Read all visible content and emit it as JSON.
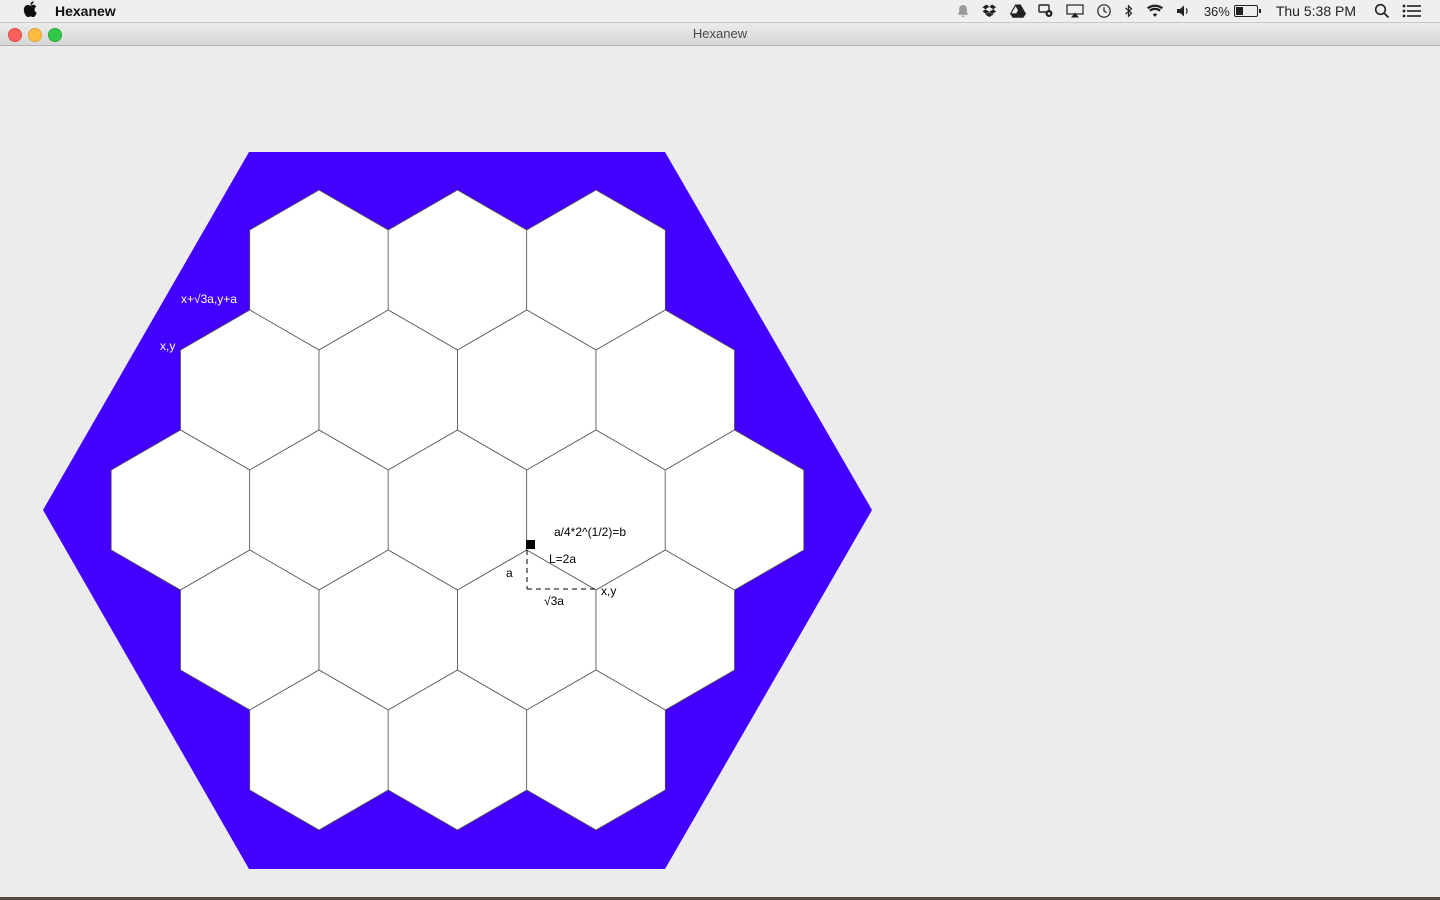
{
  "menubar": {
    "apple_icon": "apple-logo-icon",
    "app_name": "Hexanew",
    "battery_percent": "36%",
    "battery_level": 0.36,
    "clock": "Thu 5:38 PM",
    "icons": [
      "notification-bell-icon",
      "dropbox-icon",
      "google-drive-icon",
      "sync-icon",
      "airplay-icon",
      "time-machine-icon",
      "bluetooth-icon",
      "wifi-icon",
      "volume-icon",
      "spotlight-icon",
      "notification-center-icon"
    ]
  },
  "window": {
    "title": "Hexanew"
  },
  "board": {
    "border_color": "#4400ff",
    "cell_color": "#ffffff",
    "row_counts": [
      3,
      4,
      5,
      4,
      3
    ],
    "labels": {
      "corner_upper": "x+√3a,y+a",
      "corner_lower": "x,y",
      "formula": "a/4*2^(1/2)=b",
      "side_length": "L=2a",
      "side_a": "a",
      "side_root3a": "√3a",
      "point_xy": "x,y"
    }
  }
}
